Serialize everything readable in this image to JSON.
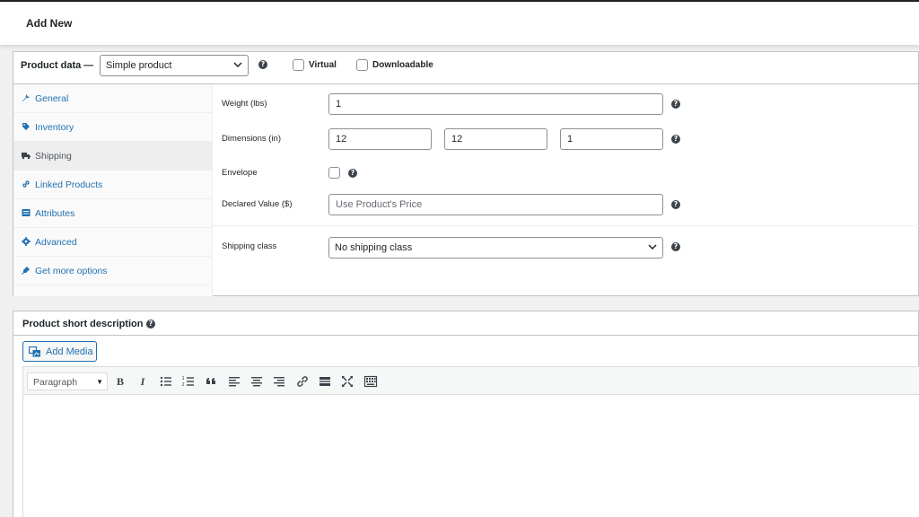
{
  "header": {
    "title": "Add New"
  },
  "product_data": {
    "label": "Product data —",
    "type_select": "Simple product",
    "virtual_label": "Virtual",
    "downloadable_label": "Downloadable",
    "tabs": [
      {
        "label": "General",
        "icon": "wrench-icon"
      },
      {
        "label": "Inventory",
        "icon": "tag-icon"
      },
      {
        "label": "Shipping",
        "icon": "truck-icon",
        "active": true
      },
      {
        "label": "Linked Products",
        "icon": "link-icon"
      },
      {
        "label": "Attributes",
        "icon": "list-icon"
      },
      {
        "label": "Advanced",
        "icon": "gear-icon"
      },
      {
        "label": "Get more options",
        "icon": "plugin-icon"
      }
    ],
    "shipping": {
      "weight_label": "Weight (lbs)",
      "weight_value": "1",
      "dimensions_label": "Dimensions (in)",
      "length": "12",
      "width": "12",
      "height": "1",
      "envelope_label": "Envelope",
      "declared_label": "Declared Value ($)",
      "declared_placeholder": "Use Product's Price",
      "class_label": "Shipping class",
      "class_value": "No shipping class"
    }
  },
  "short_description": {
    "label": "Product short description",
    "add_media": "Add Media",
    "format": "Paragraph",
    "toolbar": [
      "B",
      "I",
      "bullet-list-icon",
      "numbered-list-icon",
      "quote-icon",
      "align-left-icon",
      "align-center-icon",
      "align-right-icon",
      "link-icon",
      "read-more-icon",
      "fullscreen-icon",
      "toolbar-toggle-icon"
    ]
  },
  "colors": {
    "accent": "#2271b1",
    "text": "#1d2327",
    "background": "#f0f0f1"
  }
}
